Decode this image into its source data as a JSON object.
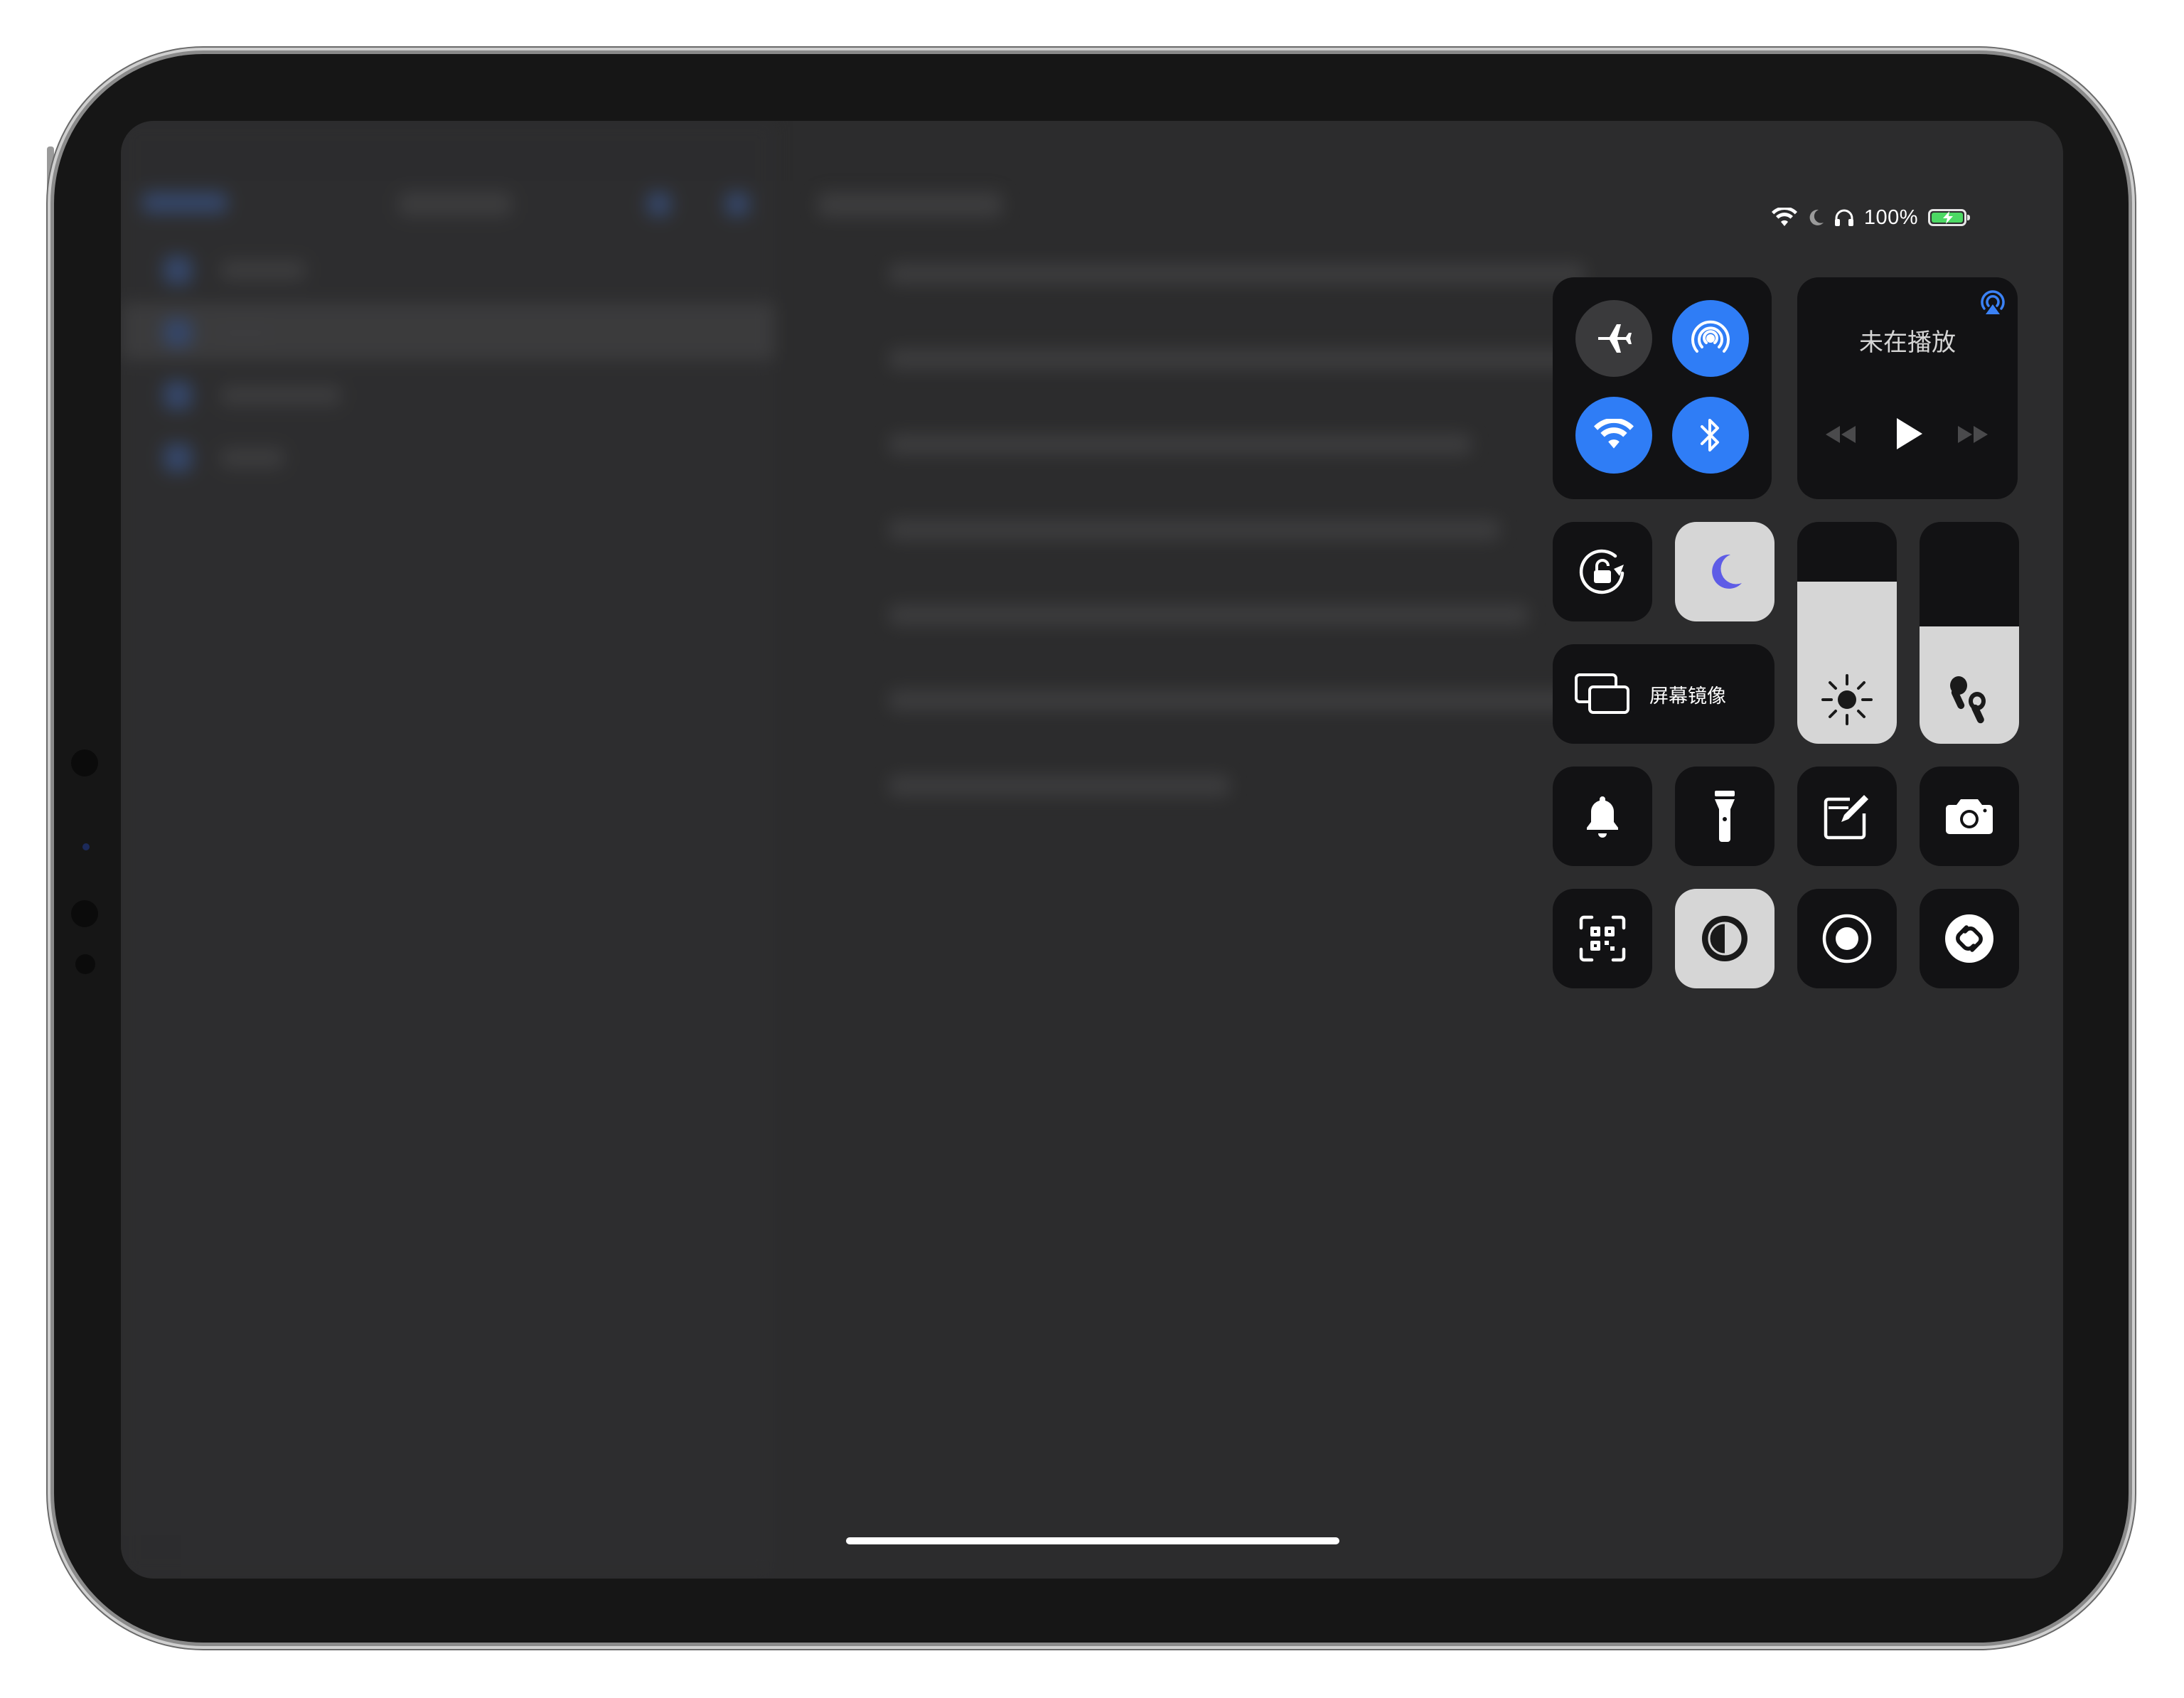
{
  "status_bar": {
    "battery_text": "100%",
    "battery_level": 1.0,
    "icons": [
      "wifi-icon",
      "moon-icon",
      "headphones-icon",
      "battery-charging-icon"
    ]
  },
  "control_center": {
    "connectivity": {
      "airplane_mode": {
        "icon": "airplane-icon",
        "on": false
      },
      "airdrop": {
        "icon": "airdrop-icon",
        "on": true
      },
      "wifi": {
        "icon": "wifi-icon",
        "on": true
      },
      "bluetooth": {
        "icon": "bluetooth-icon",
        "on": true
      }
    },
    "now_playing": {
      "title": "未在播放",
      "icons": [
        "airplay-audio-icon",
        "rewind-icon",
        "play-icon",
        "fast-forward-icon"
      ]
    },
    "rotation_lock": {
      "icon": "rotation-lock-icon",
      "on": false
    },
    "focus": {
      "icon": "moon-icon",
      "on": true
    },
    "screen_mirroring": {
      "label": "屏幕镜像",
      "icon": "screen-mirroring-icon"
    },
    "brightness": {
      "icon": "sun-icon",
      "level": 0.73
    },
    "volume": {
      "icon": "airpods-icon",
      "level": 0.53
    },
    "row3": [
      {
        "name": "silent-mode",
        "icon": "bell-icon"
      },
      {
        "name": "flashlight",
        "icon": "flashlight-icon"
      },
      {
        "name": "notes",
        "icon": "note-edit-icon"
      },
      {
        "name": "camera",
        "icon": "camera-icon"
      }
    ],
    "row4": [
      {
        "name": "code-scanner",
        "icon": "qr-scanner-icon"
      },
      {
        "name": "dark-mode",
        "icon": "dark-mode-icon",
        "on": true
      },
      {
        "name": "screen-recording",
        "icon": "record-icon"
      },
      {
        "name": "shazam",
        "icon": "shazam-icon"
      }
    ]
  },
  "colors": {
    "accent_blue": "#2f7df6",
    "focus_purple": "#5e5ce6",
    "battery_green": "#4cd964",
    "tile_dark": "#121214",
    "tile_light": "#d6d6d6"
  }
}
